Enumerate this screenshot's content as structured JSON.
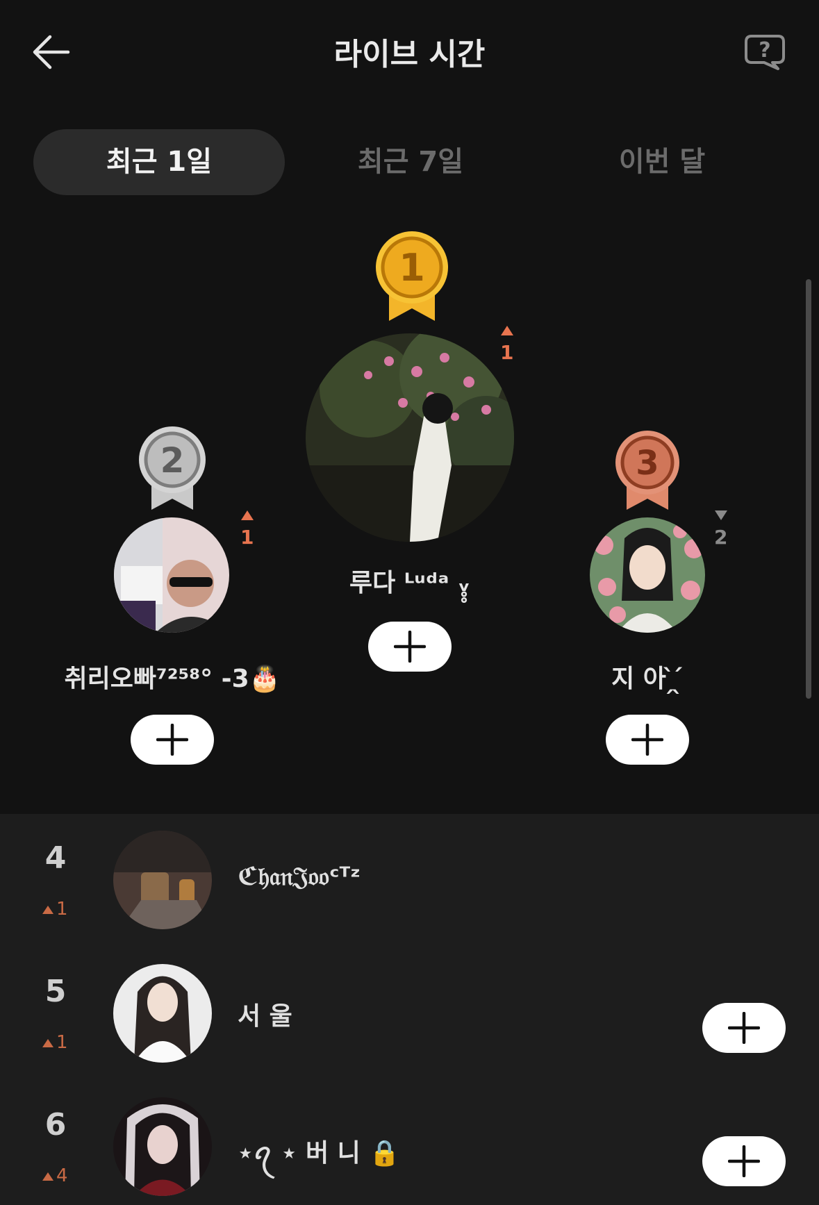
{
  "header": {
    "title": "라이브 시간",
    "back_icon": "arrow-left-icon",
    "help_icon": "question-bubble-icon"
  },
  "tabs": [
    {
      "label": "최근 1일",
      "active": true
    },
    {
      "label": "최근 7일",
      "active": false
    },
    {
      "label": "이번 달",
      "active": false
    }
  ],
  "podium": {
    "first": {
      "rank": "1",
      "name": "루다 ᴸᵘᵈᵃ  ᵥ̥̥",
      "change": "1",
      "direction": "up"
    },
    "second": {
      "rank": "2",
      "name": "취리오빠⁷²⁵⁸° -3🎂",
      "change": "1",
      "direction": "up"
    },
    "third": {
      "rank": "3",
      "name": "지 아 ̗̀ ̖́",
      "change": "2",
      "direction": "down"
    }
  },
  "list": [
    {
      "rank": "4",
      "change": "1",
      "direction": "up",
      "name": "ℭ𝔥𝔞𝔫𝔍𝔬𝔬ᶜᵀᶻ",
      "has_add": false
    },
    {
      "rank": "5",
      "change": "1",
      "direction": "up",
      "name": "서 울",
      "has_add": true
    },
    {
      "rank": "6",
      "change": "4",
      "direction": "up",
      "name": "⋆ꪖ ⋆ 버 니 🔒",
      "has_add": true
    }
  ],
  "icons": {
    "add": "plus-icon",
    "up": "triangle-up-icon",
    "down": "triangle-down-icon"
  },
  "colors": {
    "background": "#121212",
    "list_background": "#1d1d1d",
    "rank_up": "#e8744f",
    "gold": "#f2b62b",
    "silver": "#b8b8b8",
    "bronze": "#d37a63"
  }
}
